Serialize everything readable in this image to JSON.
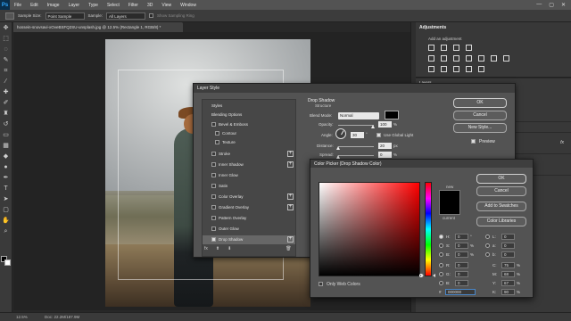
{
  "app": {
    "logo": "Ps",
    "menu": [
      "File",
      "Edit",
      "Image",
      "Layer",
      "Type",
      "Select",
      "Filter",
      "3D",
      "View",
      "Window"
    ],
    "window_controls": [
      "—",
      "▢",
      "✕"
    ]
  },
  "options_bar": {
    "sample_size_label": "Sample Size:",
    "sample_size_value": "Point Sample",
    "sample_label": "Sample:",
    "sample_value": "All Layers",
    "show_ring_label": "Show Sampling Ring"
  },
  "document": {
    "tab_title": "hossein-snovsavi-xOveBSFQ2SU-unsplash.jpg @ 12.5% (Rectangle 1, RGB/8) *"
  },
  "status": {
    "zoom": "12.5%",
    "doc": "Doc: 22.2M/187.9M"
  },
  "adjustments": {
    "title": "Adjustments",
    "subtitle": "Add an adjustment"
  },
  "layers": {
    "tab": "Layers",
    "fx": "fx"
  },
  "layer_style": {
    "title": "Layer Style",
    "items": [
      {
        "label": "Styles",
        "type": "header"
      },
      {
        "label": "Blending Options",
        "type": "header"
      },
      {
        "label": "Bevel & Emboss",
        "type": "check"
      },
      {
        "label": "Contour",
        "type": "sub"
      },
      {
        "label": "Texture",
        "type": "sub"
      },
      {
        "label": "Stroke",
        "type": "plus"
      },
      {
        "label": "Inner Shadow",
        "type": "plus"
      },
      {
        "label": "Inner Glow",
        "type": "check"
      },
      {
        "label": "Satin",
        "type": "check"
      },
      {
        "label": "Color Overlay",
        "type": "plus"
      },
      {
        "label": "Gradient Overlay",
        "type": "plus"
      },
      {
        "label": "Pattern Overlay",
        "type": "check"
      },
      {
        "label": "Outer Glow",
        "type": "check"
      },
      {
        "label": "Drop Shadow",
        "type": "plus",
        "selected": true,
        "checked": true
      }
    ],
    "footer_fx": "fx",
    "section_title": "Drop Shadow",
    "section_sub": "Structure",
    "blend_mode_label": "Blend Mode:",
    "blend_mode_value": "Normal",
    "opacity_label": "Opacity:",
    "opacity_value": "100",
    "opacity_unit": "%",
    "angle_label": "Angle:",
    "angle_value": "30",
    "angle_unit": "°",
    "global_light_label": "Use Global Light",
    "distance_label": "Distance:",
    "distance_value": "20",
    "distance_unit": "px",
    "spread_label": "Spread:",
    "spread_value": "0",
    "spread_unit": "%",
    "ok": "OK",
    "cancel": "Cancel",
    "new_style": "New Style...",
    "preview": "Preview"
  },
  "color_picker": {
    "title": "Color Picker (Drop Shadow Color)",
    "new_label": "new",
    "current_label": "current",
    "ok": "OK",
    "cancel": "Cancel",
    "add_swatches": "Add to Swatches",
    "libraries": "Color Libraries",
    "only_web": "Only Web Colors",
    "fields": {
      "H": {
        "value": "0",
        "unit": "°"
      },
      "S": {
        "value": "0",
        "unit": "%"
      },
      "B": {
        "value": "0",
        "unit": "%"
      },
      "R": {
        "value": "0",
        "unit": ""
      },
      "G": {
        "value": "0",
        "unit": ""
      },
      "Bl": {
        "label": "B:",
        "value": "0",
        "unit": ""
      },
      "L": {
        "value": "0",
        "unit": ""
      },
      "a": {
        "value": "0",
        "unit": ""
      },
      "b": {
        "value": "0",
        "unit": ""
      },
      "C": {
        "value": "75",
        "unit": "%"
      },
      "M": {
        "value": "68",
        "unit": "%"
      },
      "Y": {
        "value": "67",
        "unit": "%"
      },
      "K": {
        "value": "90",
        "unit": "%"
      }
    },
    "hex": "000000",
    "hash": "#"
  }
}
